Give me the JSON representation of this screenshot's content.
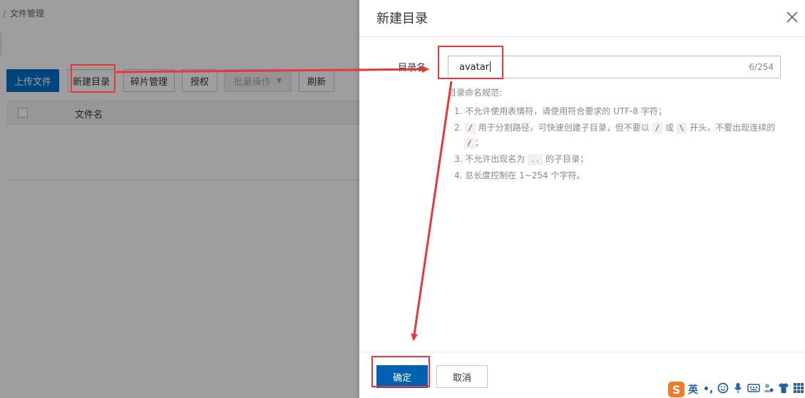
{
  "background": {
    "breadcrumb_sep": "/",
    "breadcrumb": "文件管理",
    "toolbar": {
      "upload": "上传文件",
      "new_dir": "新建目录",
      "fragments": "碎片管理",
      "authorize": "授权",
      "batch": "批量操作",
      "refresh": "刷新"
    },
    "table": {
      "col_name": "文件名"
    }
  },
  "drawer": {
    "title": "新建目录",
    "field": {
      "label": "目录名",
      "value": "avatar",
      "counter": "6/254"
    },
    "rules": {
      "title": "目录命名规范:",
      "r1": "1. 不允许使用表情符，请使用符合要求的 UTF-8 字符；",
      "r2_a": "2. ",
      "r2_code1": "/",
      "r2_b": " 用于分割路径，可快速创建子目录，但不要以 ",
      "r2_code2": "/",
      "r2_c": " 或 ",
      "r2_code3": "\\",
      "r2_d": " 开头，不要出现连续的",
      "r2_code4": "/",
      "r2_e": "；",
      "r3_a": "3. 不允许出现名为 ",
      "r3_code": "..",
      "r3_b": " 的子目录；",
      "r4": "4. 总长度控制在 1~254 个字符。"
    },
    "footer": {
      "ok": "确定",
      "cancel": "取消"
    }
  },
  "ime": {
    "logo": "S",
    "lang": "英",
    "punct": "•,",
    "icons": [
      "smiley-icon",
      "microphone-icon",
      "keyboard-icon",
      "user-icon",
      "shirt-icon",
      "grid-icon"
    ]
  },
  "colors": {
    "primary": "#0070cc",
    "annotation": "#e8363a",
    "ime_logo": "#f07a26"
  }
}
